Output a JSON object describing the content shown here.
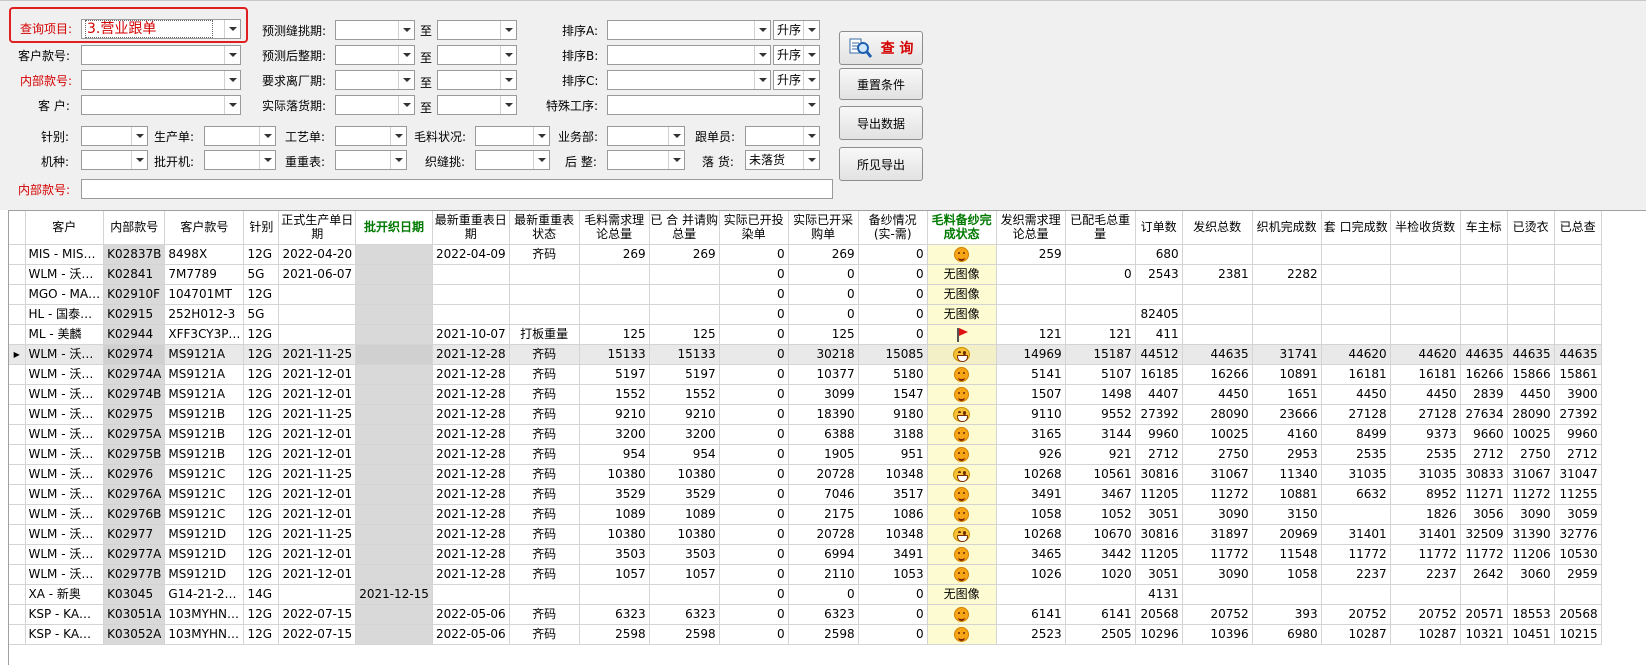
{
  "query": {
    "item_label": "查询项目:",
    "item_value": "3.营业跟单",
    "style_label": "客户款号:",
    "internal_label": "内部款号:",
    "customer_label": "客  户:",
    "predict_sew_label": "预测缝挑期:",
    "predict_finish_label": "预测后整期:",
    "require_leave_label": "要求离厂期:",
    "actual_ship_label": "实际落货期:",
    "to": "至",
    "sort_a": "排序A:",
    "sort_b": "排序B:",
    "sort_c": "排序C:",
    "asc": "升序",
    "special_label": "特殊工序:",
    "needle_label": "针别:",
    "prod_order_label": "生产单:",
    "process_label": "工艺单:",
    "yarn_status_label": "毛料状况:",
    "dept_label": "业务部:",
    "follower_label": "跟单员:",
    "machine_label": "机种:",
    "batch_machine_label": "批开机:",
    "weight_table_label": "重重表:",
    "sew_pick_label": "织缝挑:",
    "finishing_label": "后 整:",
    "shipping_label": "落  货:",
    "shipping_value": "未落货",
    "internal2_label": "内部款号:"
  },
  "buttons": {
    "search": "查 询",
    "reset": "重置条件",
    "export": "导出数据",
    "wysiwyg": "所见导出"
  },
  "colors": {
    "highlight": "#e02020",
    "label_red": "#d40000",
    "header_green": "#007a00",
    "yellow_col": "#fdfbd2",
    "grey_col": "#d9d9d9"
  },
  "table": {
    "columns": [
      "客户",
      "内部款号",
      "客户款号",
      "针别",
      "正式生产单日期",
      "批开织日期",
      "最新重重表日期",
      "最新重重表状态",
      "毛料需求理论总量",
      "已 合 并请购总量",
      "实际已开投染单",
      "实际已开采购单",
      "备纱情况(实-需)",
      "毛料备纱完成状态",
      "发织需求理论总量",
      "已配毛总重量",
      "订单数",
      "发织总数",
      "织机完成数",
      "套 口完成数",
      "半检收货数",
      "车主标",
      "已烫衣",
      "已总查"
    ],
    "rows": [
      [
        "MIS - MIS…",
        "K02837B",
        "8498X",
        "12G",
        "2022-04-20",
        "",
        "2022-04-09",
        "齐码",
        "269",
        "269",
        "0",
        "269",
        "0",
        "smile",
        "259",
        "",
        "680",
        "",
        "",
        "",
        "",
        "",
        "",
        ""
      ],
      [
        "WLM - 沃…",
        "K02841",
        "7M7789",
        "5G",
        "2021-06-07",
        "",
        "",
        "",
        "",
        "",
        "0",
        "0",
        "0",
        "无图像",
        "",
        "0",
        "2543",
        "2381",
        "2282",
        "",
        "",
        "",
        "",
        ""
      ],
      [
        "MGO - MA…",
        "K02910F",
        "104701MT",
        "12G",
        "",
        "",
        "",
        "",
        "",
        "",
        "0",
        "0",
        "0",
        "无图像",
        "",
        "",
        "",
        "",
        "",
        "",
        "",
        "",
        "",
        ""
      ],
      [
        "HL - 国泰…",
        "K02915",
        "252H012-3",
        "5G",
        "",
        "",
        "",
        "",
        "",
        "",
        "0",
        "0",
        "0",
        "无图像",
        "",
        "",
        "82405",
        "",
        "",
        "",
        "",
        "",
        "",
        ""
      ],
      [
        "ML - 美麟",
        "K02944",
        "XFF3CY3P…",
        "12G",
        "",
        "",
        "2021-10-07",
        "打板重量",
        "125",
        "125",
        "0",
        "125",
        "0",
        "flag",
        "121",
        "121",
        "411",
        "",
        "",
        "",
        "",
        "",
        "",
        ""
      ],
      [
        "WLM - 沃…",
        "K02974",
        "MS9121A",
        "12G",
        "2021-11-25",
        "",
        "2021-12-28",
        "齐码",
        "15133",
        "15133",
        "0",
        "30218",
        "15085",
        "grin",
        "14969",
        "15187",
        "44512",
        "44635",
        "31741",
        "44620",
        "44620",
        "44635",
        "44635",
        "44635"
      ],
      [
        "WLM - 沃…",
        "K02974A",
        "MS9121A",
        "12G",
        "2021-12-01",
        "",
        "2021-12-28",
        "齐码",
        "5197",
        "5197",
        "0",
        "10377",
        "5180",
        "smile",
        "5141",
        "5107",
        "16185",
        "16266",
        "10891",
        "16181",
        "16181",
        "16266",
        "15866",
        "15861"
      ],
      [
        "WLM - 沃…",
        "K02974B",
        "MS9121A",
        "12G",
        "2021-12-01",
        "",
        "2021-12-28",
        "齐码",
        "1552",
        "1552",
        "0",
        "3099",
        "1547",
        "smile",
        "1507",
        "1498",
        "4407",
        "4450",
        "1651",
        "4450",
        "4450",
        "2839",
        "4450",
        "3900"
      ],
      [
        "WLM - 沃…",
        "K02975",
        "MS9121B",
        "12G",
        "2021-11-25",
        "",
        "2021-12-28",
        "齐码",
        "9210",
        "9210",
        "0",
        "18390",
        "9180",
        "grin",
        "9110",
        "9552",
        "27392",
        "28090",
        "23666",
        "27128",
        "27128",
        "27634",
        "28090",
        "27392"
      ],
      [
        "WLM - 沃…",
        "K02975A",
        "MS9121B",
        "12G",
        "2021-12-01",
        "",
        "2021-12-28",
        "齐码",
        "3200",
        "3200",
        "0",
        "6388",
        "3188",
        "smile",
        "3165",
        "3144",
        "9960",
        "10025",
        "4160",
        "8499",
        "9373",
        "9660",
        "10025",
        "9960"
      ],
      [
        "WLM - 沃…",
        "K02975B",
        "MS9121B",
        "12G",
        "2021-12-01",
        "",
        "2021-12-28",
        "齐码",
        "954",
        "954",
        "0",
        "1905",
        "951",
        "smile",
        "926",
        "921",
        "2712",
        "2750",
        "2953",
        "2535",
        "2535",
        "2712",
        "2750",
        "2712"
      ],
      [
        "WLM - 沃…",
        "K02976",
        "MS9121C",
        "12G",
        "2021-11-25",
        "",
        "2021-12-28",
        "齐码",
        "10380",
        "10380",
        "0",
        "20728",
        "10348",
        "grin",
        "10268",
        "10561",
        "30816",
        "31067",
        "11340",
        "31035",
        "31035",
        "30833",
        "31067",
        "31047"
      ],
      [
        "WLM - 沃…",
        "K02976A",
        "MS9121C",
        "12G",
        "2021-12-01",
        "",
        "2021-12-28",
        "齐码",
        "3529",
        "3529",
        "0",
        "7046",
        "3517",
        "smile",
        "3491",
        "3467",
        "11205",
        "11272",
        "10881",
        "6632",
        "8952",
        "11271",
        "11272",
        "11255"
      ],
      [
        "WLM - 沃…",
        "K02976B",
        "MS9121C",
        "12G",
        "2021-12-01",
        "",
        "2021-12-28",
        "齐码",
        "1089",
        "1089",
        "0",
        "2175",
        "1086",
        "smile",
        "1058",
        "1052",
        "3051",
        "3090",
        "3150",
        "",
        "1826",
        "3056",
        "3090",
        "3059"
      ],
      [
        "WLM - 沃…",
        "K02977",
        "MS9121D",
        "12G",
        "2021-11-25",
        "",
        "2021-12-28",
        "齐码",
        "10380",
        "10380",
        "0",
        "20728",
        "10348",
        "grin",
        "10268",
        "10670",
        "30816",
        "31897",
        "20969",
        "31401",
        "31401",
        "32509",
        "31390",
        "32776"
      ],
      [
        "WLM - 沃…",
        "K02977A",
        "MS9121D",
        "12G",
        "2021-12-01",
        "",
        "2021-12-28",
        "齐码",
        "3503",
        "3503",
        "0",
        "6994",
        "3491",
        "smile",
        "3465",
        "3442",
        "11205",
        "11772",
        "11548",
        "11772",
        "11772",
        "11772",
        "11206",
        "10530"
      ],
      [
        "WLM - 沃…",
        "K02977B",
        "MS9121D",
        "12G",
        "2021-12-01",
        "",
        "2021-12-28",
        "齐码",
        "1057",
        "1057",
        "0",
        "2110",
        "1053",
        "smile",
        "1026",
        "1020",
        "3051",
        "3090",
        "1058",
        "2237",
        "2237",
        "2642",
        "3060",
        "2959"
      ],
      [
        "XA - 新奥",
        "K03045",
        "G14-21-2…",
        "14G",
        "",
        "2021-12-15",
        "",
        "",
        "",
        "",
        "0",
        "0",
        "0",
        "无图像",
        "",
        "",
        "4131",
        "",
        "",
        "",
        "",
        "",
        "",
        ""
      ],
      [
        "KSP - KA…",
        "K03051A",
        "103MYHN…",
        "12G",
        "2022-07-15",
        "",
        "2022-05-06",
        "齐码",
        "6323",
        "6323",
        "0",
        "6323",
        "0",
        "smile",
        "6141",
        "6141",
        "20568",
        "20752",
        "393",
        "20752",
        "20752",
        "20571",
        "18553",
        "20568"
      ],
      [
        "KSP - KA…",
        "K03052A",
        "103MYHN…",
        "12G",
        "2022-07-15",
        "",
        "2022-05-06",
        "齐码",
        "2598",
        "2598",
        "0",
        "2598",
        "0",
        "smile",
        "2523",
        "2505",
        "10296",
        "10396",
        "6980",
        "10287",
        "10287",
        "10321",
        "10451",
        "10215"
      ]
    ]
  }
}
